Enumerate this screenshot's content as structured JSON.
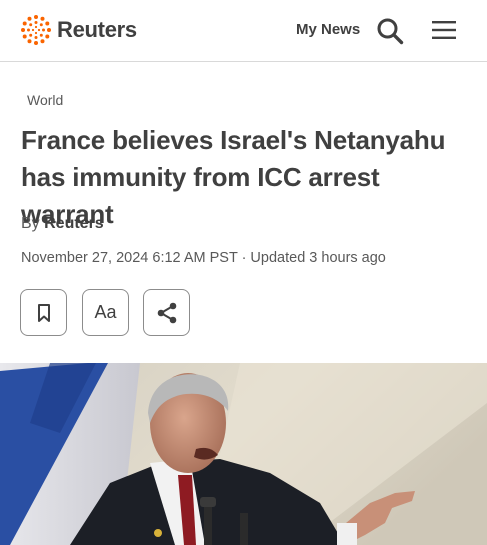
{
  "header": {
    "brand": "Reuters",
    "my_news": "My News",
    "search_icon": "search-icon",
    "menu_icon": "hamburger-menu-icon"
  },
  "article": {
    "section": "World",
    "headline": "France believes Israel's Netanyahu has immunity from ICC arrest warrant",
    "byline_prefix": "By",
    "author": "Reuters",
    "dateline": "November 27, 2024 6:12 AM PST · Updated 3 hours ago"
  },
  "toolbar": {
    "bookmark_icon": "bookmark-icon",
    "text_size_label": "Aa",
    "share_icon": "share-icon"
  },
  "colors": {
    "accent": "#fa6400",
    "text": "#404040",
    "muted": "#595959",
    "border": "#8c8c8c"
  }
}
